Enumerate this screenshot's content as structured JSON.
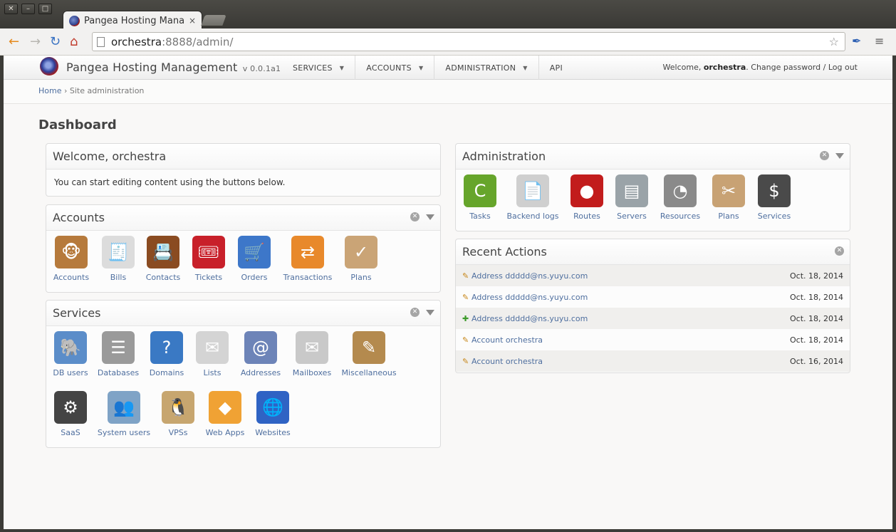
{
  "browser": {
    "tab_title": "Pangea Hosting Mana",
    "tab_close": "×",
    "url_host": "orchestra",
    "url_rest": ":8888/admin/",
    "window_buttons": [
      "✕",
      "–",
      "□"
    ],
    "icons": {
      "back": "←",
      "forward": "→",
      "reload": "↻",
      "home": "⌂",
      "star": "☆",
      "menu": "≡"
    }
  },
  "header": {
    "brand": "Pangea Hosting Management",
    "version": "v 0.0.1a1",
    "nav": [
      {
        "label": "SERVICES",
        "caret": "▼"
      },
      {
        "label": "ACCOUNTS",
        "caret": "▼"
      },
      {
        "label": "ADMINISTRATION",
        "caret": "▼"
      },
      {
        "label": "API",
        "caret": ""
      }
    ],
    "welcome_prefix": "Welcome, ",
    "username": "orchestra",
    "welcome_suffix": ". ",
    "change_password": "Change password",
    "separator": " / ",
    "logout": "Log out"
  },
  "breadcrumbs": {
    "home": "Home",
    "sep": " › ",
    "current": "Site administration"
  },
  "page_title": "Dashboard",
  "welcome_module": {
    "title": "Welcome, orchestra",
    "text": "You can start editing content using the buttons below."
  },
  "accounts_module": {
    "title": "Accounts",
    "items": [
      {
        "label": "Accounts",
        "icon": "🐵",
        "color": "#b67a3c"
      },
      {
        "label": "Bills",
        "icon": "🧾",
        "color": "#dcdcdc"
      },
      {
        "label": "Contacts",
        "icon": "📇",
        "color": "#8a4b21"
      },
      {
        "label": "Tickets",
        "icon": "🎟",
        "color": "#c8202a"
      },
      {
        "label": "Orders",
        "icon": "🛒",
        "color": "#3d77c9"
      },
      {
        "label": "Transactions",
        "icon": "⇄",
        "color": "#e8892b"
      },
      {
        "label": "Plans",
        "icon": "✓",
        "color": "#caa476"
      }
    ]
  },
  "services_module": {
    "title": "Services",
    "items": [
      {
        "label": "DB users",
        "icon": "🐘",
        "color": "#5b8dc9"
      },
      {
        "label": "Databases",
        "icon": "☰",
        "color": "#9a9a9a"
      },
      {
        "label": "Domains",
        "icon": "?",
        "color": "#3a79c4"
      },
      {
        "label": "Lists",
        "icon": "✉",
        "color": "#d4d4d4"
      },
      {
        "label": "Addresses",
        "icon": "@",
        "color": "#6d84b8"
      },
      {
        "label": "Mailboxes",
        "icon": "✉",
        "color": "#c9c9c9"
      },
      {
        "label": "Miscellaneous",
        "icon": "✎",
        "color": "#b48a4e"
      },
      {
        "label": "SaaS",
        "icon": "⚙",
        "color": "#444444"
      },
      {
        "label": "System users",
        "icon": "👥",
        "color": "#7fa3c6"
      },
      {
        "label": "VPSs",
        "icon": "🐧",
        "color": "#c7a66f"
      },
      {
        "label": "Web Apps",
        "icon": "◆",
        "color": "#f0a234"
      },
      {
        "label": "Websites",
        "icon": "🌐",
        "color": "#2f63c4"
      }
    ]
  },
  "administration_module": {
    "title": "Administration",
    "items": [
      {
        "label": "Tasks",
        "icon": "C",
        "color": "#66a52b"
      },
      {
        "label": "Backend logs",
        "icon": "📄",
        "color": "#cfcfcf"
      },
      {
        "label": "Routes",
        "icon": "●",
        "color": "#c21c1c"
      },
      {
        "label": "Servers",
        "icon": "▤",
        "color": "#9aa3a8"
      },
      {
        "label": "Resources",
        "icon": "◔",
        "color": "#8a8a8a"
      },
      {
        "label": "Plans",
        "icon": "✂",
        "color": "#c8a274"
      },
      {
        "label": "Services",
        "icon": "$",
        "color": "#4a4a4a"
      }
    ]
  },
  "recent_actions": {
    "title": "Recent Actions",
    "rows": [
      {
        "type": "change",
        "symbol": "✎",
        "text": "Address ddddd@ns.yuyu.com",
        "date": "Oct. 18, 2014"
      },
      {
        "type": "change",
        "symbol": "✎",
        "text": "Address ddddd@ns.yuyu.com",
        "date": "Oct. 18, 2014"
      },
      {
        "type": "add",
        "symbol": "✚",
        "text": "Address ddddd@ns.yuyu.com",
        "date": "Oct. 18, 2014"
      },
      {
        "type": "change",
        "symbol": "✎",
        "text": "Account orchestra",
        "date": "Oct. 18, 2014"
      },
      {
        "type": "change",
        "symbol": "✎",
        "text": "Account orchestra",
        "date": "Oct. 16, 2014"
      }
    ]
  }
}
